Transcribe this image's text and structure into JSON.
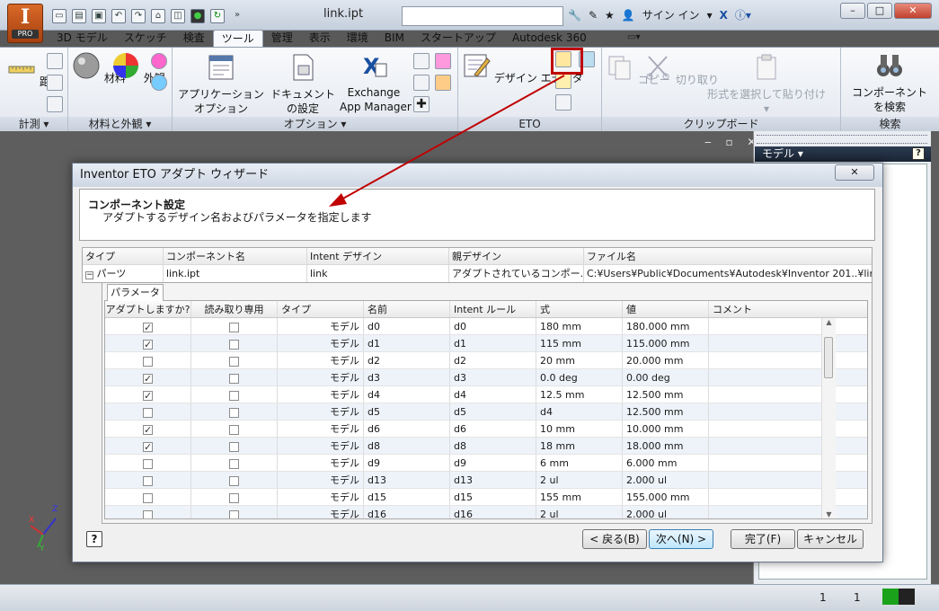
{
  "app": {
    "logo_letter": "I",
    "logo_badge": "PRO",
    "document_title": "link.ipt",
    "sign_in": "サイン イン"
  },
  "tabs": [
    "3D モデル",
    "スケッチ",
    "検査",
    "ツール",
    "管理",
    "表示",
    "環境",
    "BIM",
    "スタートアップ",
    "Autodesk 360"
  ],
  "active_tab": "ツール",
  "ribbon": {
    "measure": {
      "distance": "距離",
      "title": "計測"
    },
    "material": {
      "material": "材料",
      "appearance": "外観",
      "title": "材料と外観"
    },
    "options": {
      "app_options_1": "アプリケーション",
      "app_options_2": "オプション",
      "doc_settings_1": "ドキュメント",
      "doc_settings_2": "の設定",
      "exchange_1": "Exchange",
      "exchange_2": "App Manager",
      "title": "オプション"
    },
    "eto": {
      "design_editor": "デザイン エディタ",
      "title": "ETO"
    },
    "clipboard": {
      "copy": "コピー",
      "cut": "切り取り",
      "paste_special": "形式を選択して貼り付け",
      "title": "クリップボード"
    },
    "search": {
      "find_1": "コンポーネント",
      "find_2": "を検索",
      "title": "検索"
    }
  },
  "browser": {
    "title": "モデル"
  },
  "dialog": {
    "title": "Inventor ETO アダプト ウィザード",
    "heading": "コンポーネント設定",
    "subheading": "アダプトするデザイン名およびパラメータを指定します",
    "component_headers": [
      "タイプ",
      "コンポーネント名",
      "Intent デザイン",
      "親デザイン",
      "ファイル名"
    ],
    "component_row": {
      "type": "パーツ",
      "name": "link.ipt",
      "intent": "link",
      "parent": "アダプトされているコンポー...",
      "file": "C:¥Users¥Public¥Documents¥Autodesk¥Inventor 201..¥link.ipt"
    },
    "param_tab": "パラメータ",
    "param_headers": [
      "アダプトしますか?",
      "読み取り専用",
      "タイプ",
      "名前",
      "Intent ルール",
      "式",
      "値",
      "コメント"
    ],
    "params": [
      {
        "adapt": true,
        "readonly": false,
        "type": "モデル",
        "name": "d0",
        "rule": "d0",
        "expr": "180 mm",
        "value": "180.000 mm",
        "comment": ""
      },
      {
        "adapt": true,
        "readonly": false,
        "type": "モデル",
        "name": "d1",
        "rule": "d1",
        "expr": "115 mm",
        "value": "115.000 mm",
        "comment": ""
      },
      {
        "adapt": false,
        "readonly": false,
        "type": "モデル",
        "name": "d2",
        "rule": "d2",
        "expr": "20 mm",
        "value": "20.000 mm",
        "comment": ""
      },
      {
        "adapt": true,
        "readonly": false,
        "type": "モデル",
        "name": "d3",
        "rule": "d3",
        "expr": "0.0 deg",
        "value": "0.00 deg",
        "comment": ""
      },
      {
        "adapt": true,
        "readonly": false,
        "type": "モデル",
        "name": "d4",
        "rule": "d4",
        "expr": "12.5 mm",
        "value": "12.500 mm",
        "comment": ""
      },
      {
        "adapt": false,
        "readonly": false,
        "type": "モデル",
        "name": "d5",
        "rule": "d5",
        "expr": "d4",
        "value": "12.500 mm",
        "comment": ""
      },
      {
        "adapt": true,
        "readonly": false,
        "type": "モデル",
        "name": "d6",
        "rule": "d6",
        "expr": "10 mm",
        "value": "10.000 mm",
        "comment": ""
      },
      {
        "adapt": true,
        "readonly": false,
        "type": "モデル",
        "name": "d8",
        "rule": "d8",
        "expr": "18 mm",
        "value": "18.000 mm",
        "comment": ""
      },
      {
        "adapt": false,
        "readonly": false,
        "type": "モデル",
        "name": "d9",
        "rule": "d9",
        "expr": "6 mm",
        "value": "6.000 mm",
        "comment": ""
      },
      {
        "adapt": false,
        "readonly": false,
        "type": "モデル",
        "name": "d13",
        "rule": "d13",
        "expr": "2 ul",
        "value": "2.000 ul",
        "comment": ""
      },
      {
        "adapt": false,
        "readonly": false,
        "type": "モデル",
        "name": "d15",
        "rule": "d15",
        "expr": "155 mm",
        "value": "155.000 mm",
        "comment": ""
      },
      {
        "adapt": false,
        "readonly": false,
        "type": "モデル",
        "name": "d16",
        "rule": "d16",
        "expr": "2 ul",
        "value": "2.000 ul",
        "comment": ""
      }
    ],
    "buttons": {
      "back": "< 戻る(B)",
      "next": "次へ(N) >",
      "finish": "完了(F)",
      "cancel": "キャンセル"
    }
  },
  "status": {
    "value1": "1",
    "value2": "1"
  },
  "colors": {
    "annotation": "#c00000",
    "status_green": "#1aa21a"
  }
}
